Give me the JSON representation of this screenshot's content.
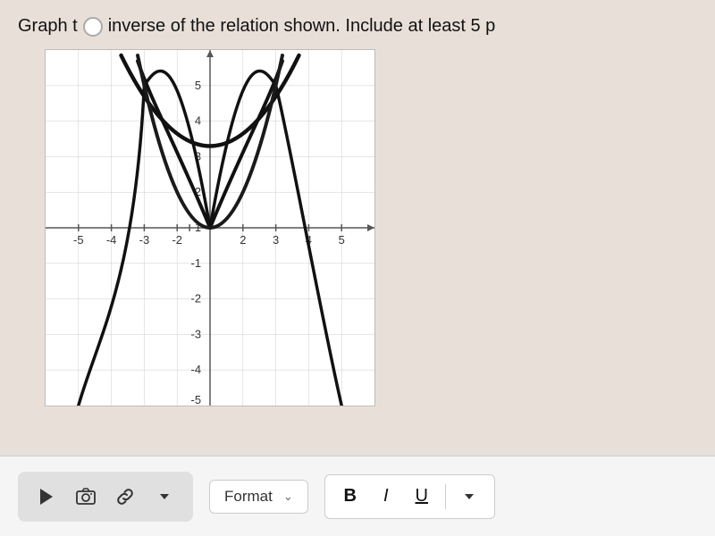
{
  "header": {
    "question_text": "Graph t",
    "question_text2": "inverse of the relation shown.  Include at least 5 p"
  },
  "toolbar": {
    "format_label": "Format",
    "bold_label": "B",
    "italic_label": "I",
    "underline_label": "U"
  },
  "graph": {
    "x_min": -5,
    "x_max": 5,
    "y_min": -5,
    "y_max": 5
  }
}
